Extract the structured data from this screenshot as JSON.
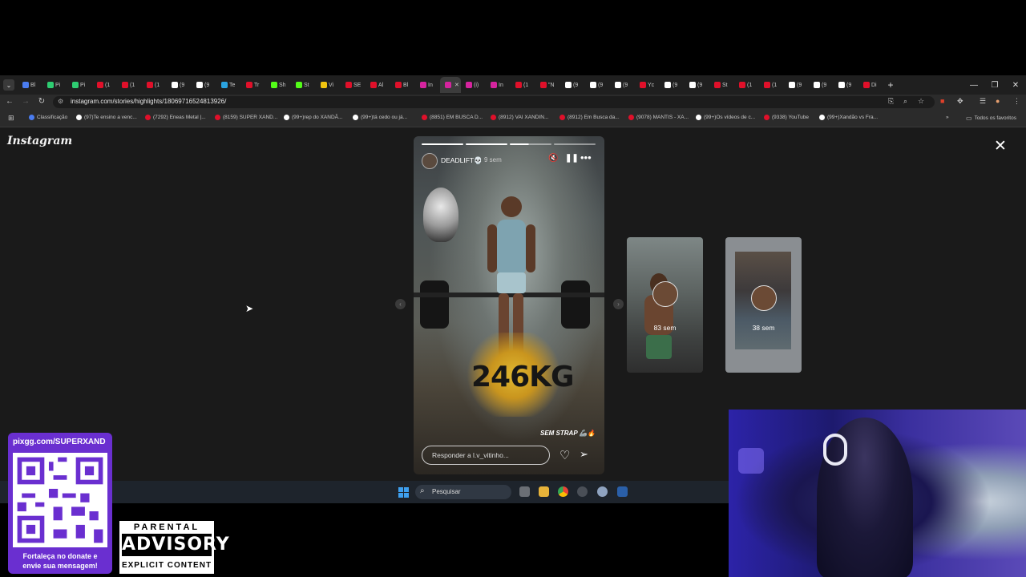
{
  "browser": {
    "tabs": [
      {
        "label": "Bl",
        "color": "#4a7cf0"
      },
      {
        "label": "Pi",
        "color": "#2ecc71"
      },
      {
        "label": "Pi",
        "color": "#2ecc71"
      },
      {
        "label": "(1",
        "color": "#e0102a"
      },
      {
        "label": "(1",
        "color": "#e0102a"
      },
      {
        "label": "(1",
        "color": "#e0102a"
      },
      {
        "label": "(9",
        "color": "#ffffff"
      },
      {
        "label": "(9",
        "color": "#ffffff"
      },
      {
        "label": "Te",
        "color": "#2aa3e0"
      },
      {
        "label": "Tr",
        "color": "#e0102a"
      },
      {
        "label": "Sh",
        "color": "#53fc18"
      },
      {
        "label": "St",
        "color": "#53fc18"
      },
      {
        "label": "Vi",
        "color": "#f1c40f"
      },
      {
        "label": "SE",
        "color": "#e0102a"
      },
      {
        "label": "Al",
        "color": "#e0102a"
      },
      {
        "label": "Bl",
        "color": "#e0102a"
      },
      {
        "label": "In",
        "color": "#d6249f"
      },
      {
        "label": "",
        "color": "#d6249f",
        "active": true
      },
      {
        "label": "(i)",
        "color": "#d6249f"
      },
      {
        "label": "In",
        "color": "#d6249f"
      },
      {
        "label": "(1",
        "color": "#e0102a"
      },
      {
        "label": "\"N",
        "color": "#e0102a"
      },
      {
        "label": "(9",
        "color": "#ffffff"
      },
      {
        "label": "(9",
        "color": "#ffffff"
      },
      {
        "label": "(9",
        "color": "#ffffff"
      },
      {
        "label": "Yc",
        "color": "#e0102a"
      },
      {
        "label": "(9",
        "color": "#ffffff"
      },
      {
        "label": "(9",
        "color": "#ffffff"
      },
      {
        "label": "St",
        "color": "#e0102a"
      },
      {
        "label": "(1",
        "color": "#e0102a"
      },
      {
        "label": "(1",
        "color": "#e0102a"
      },
      {
        "label": "(9",
        "color": "#ffffff"
      },
      {
        "label": "(9",
        "color": "#ffffff"
      },
      {
        "label": "(9",
        "color": "#ffffff"
      },
      {
        "label": "Di",
        "color": "#e0102a"
      }
    ],
    "new_tab": "+",
    "window_controls": {
      "minimize": "—",
      "restore": "❐",
      "close": "✕"
    },
    "url": "instagram.com/stories/highlights/18069716524813926/",
    "bookmarks": [
      {
        "label": "Classificação",
        "color": "#4a7cf0"
      },
      {
        "label": "(97)Te ensino a venc...",
        "color": "#ffffff"
      },
      {
        "label": "(7292) Eneas Metal |...",
        "color": "#e0102a"
      },
      {
        "label": "(8159) SUPER XAND...",
        "color": "#e0102a"
      },
      {
        "label": "(99+)rep do XANDÃ...",
        "color": "#ffffff"
      },
      {
        "label": "(99+)tá cedo ou já...",
        "color": "#ffffff"
      },
      {
        "label": "(8851) EM BUSCA D...",
        "color": "#e0102a"
      },
      {
        "label": "(8912) VAI XANDIN...",
        "color": "#e0102a"
      },
      {
        "label": "(8912) Em Busca da...",
        "color": "#e0102a"
      },
      {
        "label": "(9078) MANTIS - XA...",
        "color": "#e0102a"
      },
      {
        "label": "(99+)Os vídeos de c...",
        "color": "#ffffff"
      },
      {
        "label": "(9338) YouTube",
        "color": "#e0102a"
      },
      {
        "label": "(99+)Xandão vs Fra...",
        "color": "#ffffff"
      }
    ],
    "bookmarks_more": "»",
    "all_favorites": "Todos os favoritos"
  },
  "instagram": {
    "logo": "Instagram",
    "close_icon": "✕",
    "story": {
      "username": "DEADLIFT💀",
      "time": "9 sem",
      "weight_text": "246KG",
      "caption": "SEM STRAP 🦾🔥",
      "reply_placeholder": "Responder a l.v_vitinho..."
    },
    "next_thumbs": [
      {
        "time": "83 sem"
      },
      {
        "time": "38 sem"
      }
    ]
  },
  "taskbar": {
    "search_placeholder": "Pesquisar"
  },
  "overlays": {
    "donate_url": "pixgg.com/SUPERXAND",
    "donate_text_line1": "Fortaleça no donate e",
    "donate_text_line2": "envie sua mensagem!",
    "advisory_line1": "PARENTAL",
    "advisory_line2": "ADVISORY",
    "advisory_line3": "EXPLICIT CONTENT"
  }
}
